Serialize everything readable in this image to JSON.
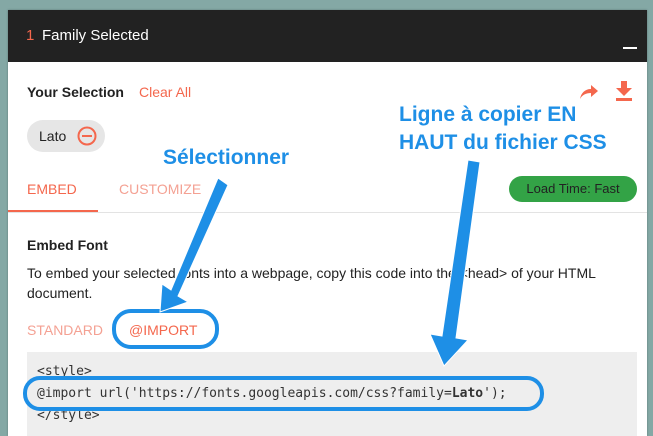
{
  "header": {
    "count": "1",
    "title": "Family Selected",
    "minimize_icon": "minimize-icon"
  },
  "selection": {
    "label": "Your Selection",
    "clear_all": "Clear All",
    "share_icon": "share-icon",
    "download_icon": "download-icon",
    "families": [
      {
        "name": "Lato",
        "remove_icon": "remove-circle-icon"
      }
    ]
  },
  "tabs": [
    {
      "label": "EMBED",
      "active": true
    },
    {
      "label": "CUSTOMIZE",
      "active": false
    }
  ],
  "load_time": "Load Time: Fast",
  "embed": {
    "heading": "Embed Font",
    "description": "To embed your selected fonts into a webpage, copy this code into the <head> of your HTML document.",
    "options": [
      {
        "label": "STANDARD",
        "active": false
      },
      {
        "label": "@IMPORT",
        "active": true
      }
    ],
    "code": {
      "line1": "<style>",
      "line2_prefix": "@import url('https://fonts.googleapis.com/css?family=",
      "line2_family": "Lato",
      "line2_suffix": "');",
      "line3": "</style>"
    }
  },
  "annotations": {
    "select": "Sélectionner",
    "copy_line1": "Ligne à copier EN",
    "copy_line2": "HAUT du fichier CSS"
  },
  "colors": {
    "accent": "#f4674d",
    "annotation_blue": "#1e8fe6",
    "badge_green": "#33a346",
    "header_bg": "#222222",
    "backdrop": "#84a8a5"
  }
}
